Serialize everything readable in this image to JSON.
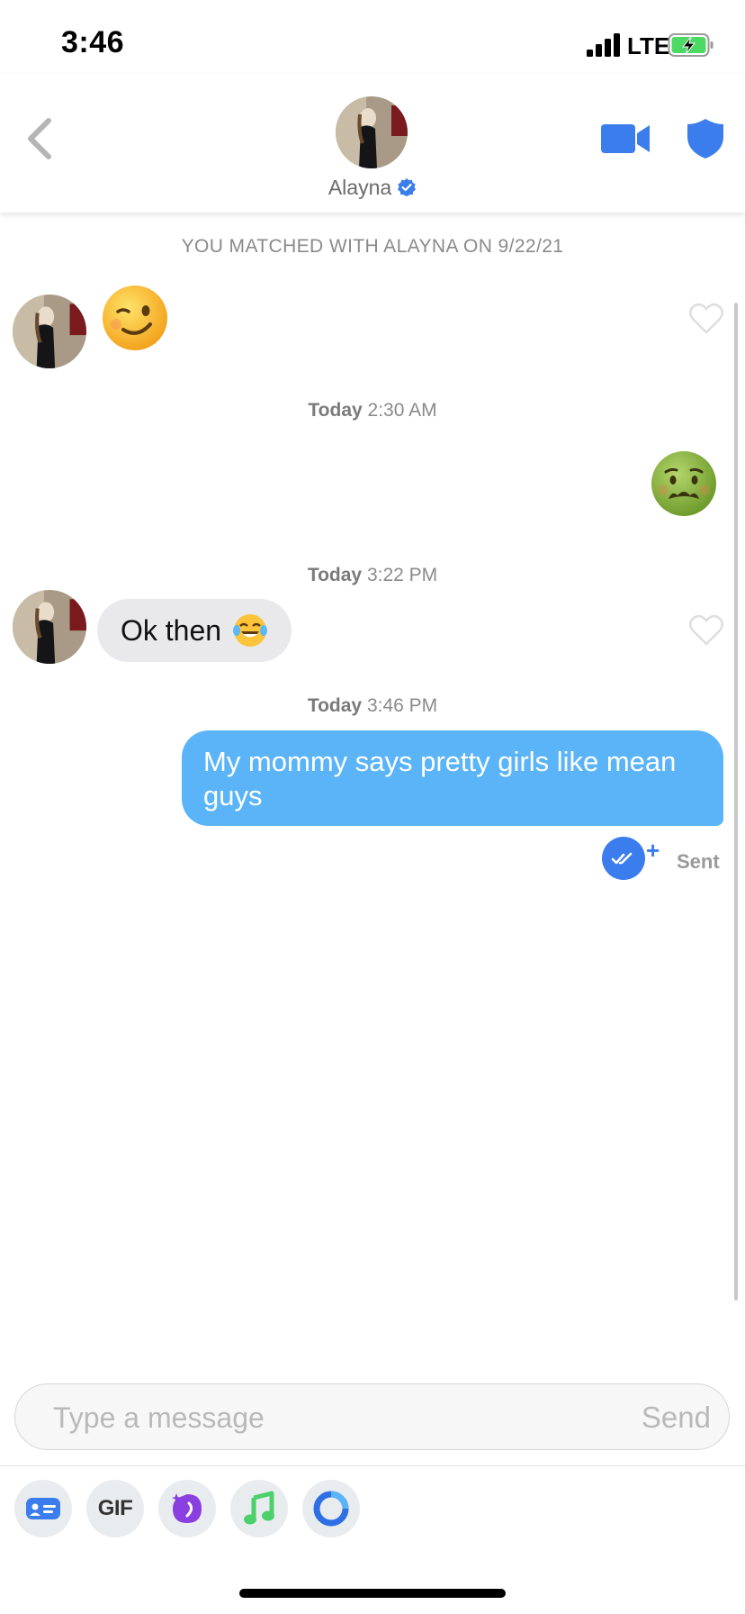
{
  "status_bar": {
    "time": "3:46",
    "network": "LTE",
    "icons": [
      "signal-icon",
      "battery-charging-icon"
    ]
  },
  "header": {
    "name": "Alayna",
    "icons": [
      "back-chevron-icon",
      "profile-avatar",
      "verified-badge-icon",
      "video-call-icon",
      "safety-shield-icon"
    ],
    "accent_color": "#3b7ded"
  },
  "chat": {
    "match_notice": "YOU MATCHED WITH ALAYNA ON 9/22/21",
    "messages": [
      {
        "from": "them",
        "type": "emoji",
        "emoji": "winking-face"
      },
      {
        "timestamp_day": "Today",
        "timestamp_time": "2:30 AM"
      },
      {
        "from": "me",
        "type": "emoji",
        "emoji": "nauseated-face"
      },
      {
        "timestamp_day": "Today",
        "timestamp_time": "3:22 PM"
      },
      {
        "from": "them",
        "type": "text",
        "text": "Ok then",
        "emoji": "tears-of-joy"
      },
      {
        "timestamp_day": "Today",
        "timestamp_time": "3:46 PM"
      },
      {
        "from": "me",
        "type": "text",
        "text": "My mommy says pretty girls like mean guys",
        "status": "Sent"
      }
    ],
    "ts1": {
      "day": "Today",
      "time": "2:30 AM"
    },
    "ts2": {
      "day": "Today",
      "time": "3:22 PM"
    },
    "ts3": {
      "day": "Today",
      "time": "3:46 PM"
    },
    "incoming_text": "Ok then",
    "outgoing_text": "My mommy says pretty girls like mean guys",
    "sent_status": "Sent",
    "read_receipt_plus": "+",
    "outgoing_bubble_color": "#5ab4f7",
    "incoming_bubble_color": "#e9e9eb"
  },
  "composer": {
    "placeholder": "Type a message",
    "send_label": "Send"
  },
  "toolbar": {
    "gif_label": "GIF",
    "icons": [
      "contact-card-icon",
      "gif-icon",
      "sparkle-sticker-icon",
      "music-note-icon",
      "ring-icon"
    ]
  }
}
